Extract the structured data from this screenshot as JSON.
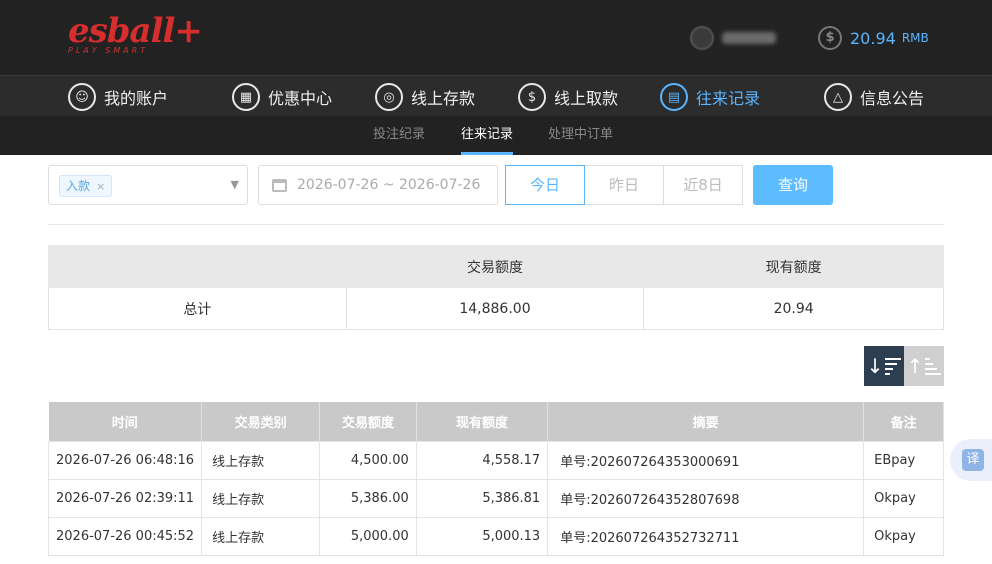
{
  "header": {
    "logo_text": "esball",
    "logo_plus": "+",
    "logo_tagline": "PLAY SMART",
    "username": "",
    "balance": "20.94",
    "currency": "RMB"
  },
  "nav": {
    "items": [
      {
        "label": "我的账户",
        "icon": "user-icon",
        "glyph": "☺"
      },
      {
        "label": "优惠中心",
        "icon": "gift-icon",
        "glyph": "▦"
      },
      {
        "label": "线上存款",
        "icon": "deposit-icon",
        "glyph": "◎"
      },
      {
        "label": "线上取款",
        "icon": "withdraw-icon",
        "glyph": "$"
      },
      {
        "label": "往来记录",
        "icon": "records-icon",
        "glyph": "▤"
      },
      {
        "label": "信息公告",
        "icon": "bell-icon",
        "glyph": "△"
      }
    ],
    "active_index": 4
  },
  "subnav": {
    "tabs": [
      "投注纪录",
      "往来记录",
      "处理中订单"
    ],
    "active_index": 1
  },
  "filters": {
    "type_tag": "入款",
    "date_range": "2026-07-26 ~ 2026-07-26",
    "quick_ranges": [
      "今日",
      "昨日",
      "近8日"
    ],
    "active_range": 0,
    "query_label": "查询"
  },
  "summary": {
    "headers": [
      "",
      "交易额度",
      "现有额度"
    ],
    "row": [
      "总计",
      "14,886.00",
      "20.94"
    ]
  },
  "records": {
    "headers": [
      "时间",
      "交易类别",
      "交易额度",
      "现有额度",
      "摘要",
      "备注"
    ],
    "rows": [
      [
        "2026-07-26 06:48:16",
        "线上存款",
        "4,500.00",
        "4,558.17",
        "单号:202607264353000691",
        "EBpay"
      ],
      [
        "2026-07-26 02:39:11",
        "线上存款",
        "5,386.00",
        "5,386.81",
        "单号:202607264352807698",
        "Okpay"
      ],
      [
        "2026-07-26 00:45:52",
        "线上存款",
        "5,000.00",
        "5,000.13",
        "单号:202607264352732711",
        "Okpay"
      ]
    ]
  },
  "translate_label": "译",
  "colors": {
    "accent": "#59b5ff",
    "brand": "#d62d2d",
    "header_bg": "#222222",
    "sort_active": "#2c3e50"
  }
}
